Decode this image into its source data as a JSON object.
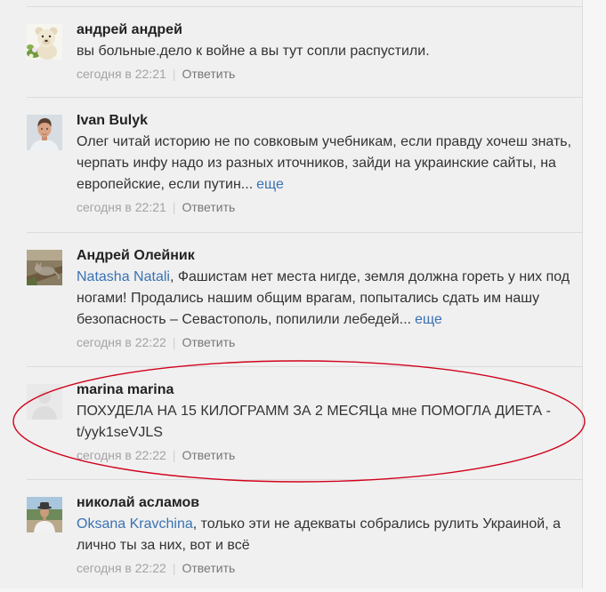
{
  "colors": {
    "background": "#f0f0f0",
    "text": "#333333",
    "author": "#222222",
    "link": "#3a72b4",
    "muted": "#a3a3a3",
    "reply": "#777777",
    "divider": "#dcdcdc",
    "highlight": "#d0021b"
  },
  "meta_separator": "|",
  "comments": [
    {
      "author": "андрей андрей",
      "text_lines": [
        "вы больные.дело к войне а вы тут сопли распустили."
      ],
      "time": "сегодня в 22:21",
      "reply_label": "Ответить"
    },
    {
      "author": "Ivan Bulyk",
      "text_lines": [
        "Олег читай историю не по совковым учебникам, если правду хочеш знать,",
        "черпать инфу надо из разных иточников, зайди на украинские сайты, на",
        "европейские, если путин..."
      ],
      "more_label": "еще",
      "time": "сегодня в 22:21",
      "reply_label": "Ответить"
    },
    {
      "author": "Андрей Олейник",
      "mention": "Natasha Natali",
      "text_lines": [
        ", Фашистам нет места нигде, земля должна гореть у них под",
        "ногами! Продались нашим общим врагам, попытались сдать им нашу",
        "безопасность – Севастополь, попилили лебедей..."
      ],
      "more_label": "еще",
      "time": "сегодня в 22:22",
      "reply_label": "Ответить"
    },
    {
      "author": "marina marina",
      "text_lines": [
        "ПОХУДЕЛА НА 15 КИЛОГРАММ ЗА 2 МЕСЯЦа мне ПОМОГЛА ДИЕТА -",
        "t/yyk1seVJLS"
      ],
      "time": "сегодня в 22:22",
      "reply_label": "Ответить"
    },
    {
      "author": "николай асламов",
      "mention": "Oksana Kravchina",
      "text_lines": [
        ", только эти не адекваты собрались рулить Украиной, а",
        "лично ты за них, вот и всё"
      ],
      "time": "сегодня в 22:22",
      "reply_label": "Ответить"
    }
  ]
}
